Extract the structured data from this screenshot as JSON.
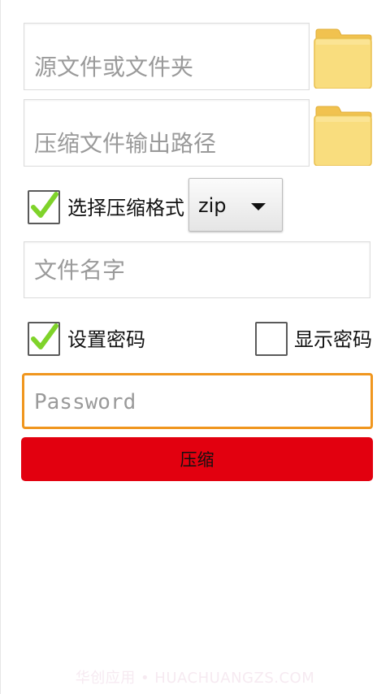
{
  "source": {
    "placeholder": "源文件或文件夹",
    "browse_icon": "folder-icon"
  },
  "output": {
    "placeholder": "压缩文件输出路径",
    "browse_icon": "folder-icon"
  },
  "format": {
    "checkbox_checked": true,
    "label": "选择压缩格式",
    "selected": "zip",
    "dropdown_icon": "triangle-down-icon"
  },
  "filename": {
    "placeholder": "文件名字"
  },
  "password_options": {
    "set_password_checked": true,
    "set_password_label": "设置密码",
    "show_password_checked": false,
    "show_password_label": "显示密码"
  },
  "password": {
    "placeholder": "Password"
  },
  "compress_button": {
    "label": "压缩"
  },
  "watermark": {
    "text": "华创应用 • HUACHUANGZS.COM"
  },
  "colors": {
    "accent_orange": "#f0961e",
    "button_red": "#e2000f",
    "check_green": "#7fd32a",
    "folder_yellow": "#f7d46a"
  }
}
